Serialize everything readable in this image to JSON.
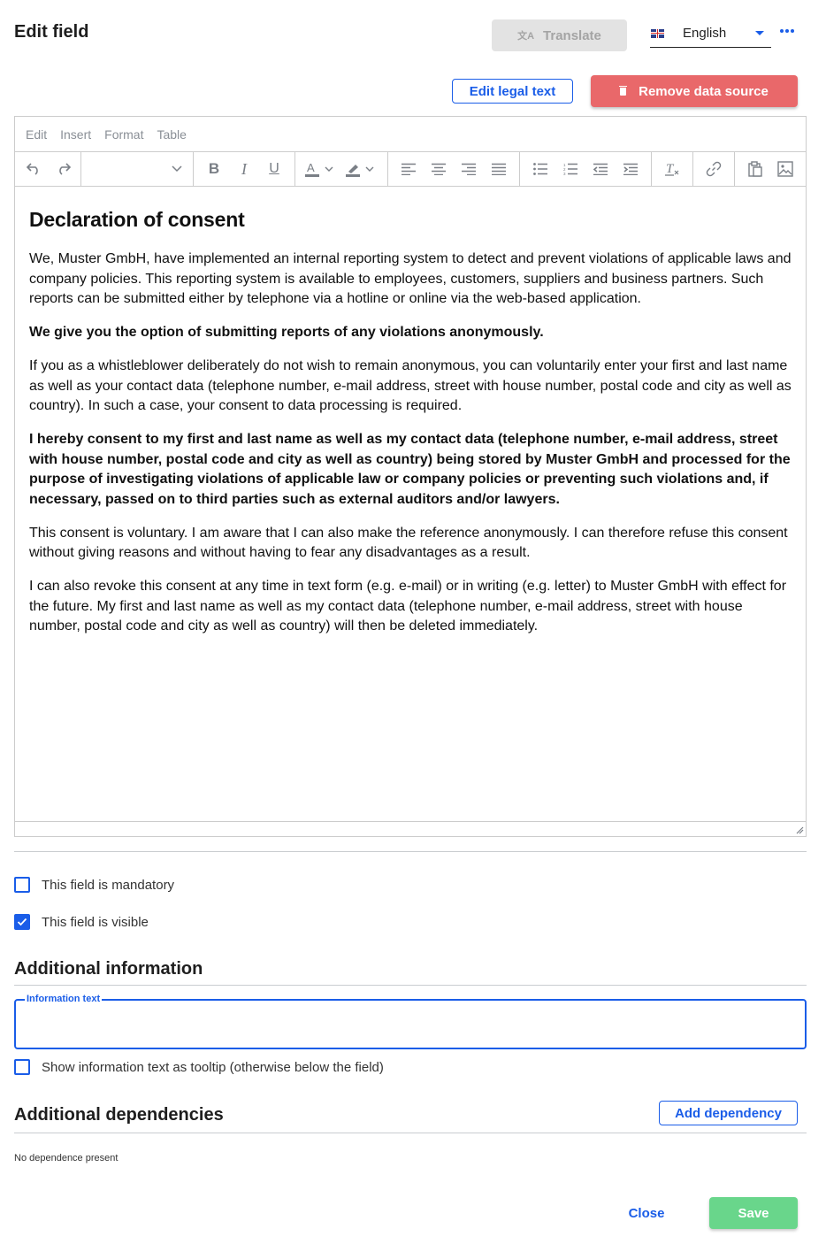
{
  "header": {
    "title": "Edit field",
    "translate_label": "Translate",
    "language": {
      "selected": "English",
      "flag_icon": "uk-flag-icon"
    },
    "more_icon": "more-horizontal-icon"
  },
  "actions": {
    "edit_legal_text_label": "Edit legal text",
    "remove_data_source_label": "Remove data source"
  },
  "editor": {
    "menu": [
      "Edit",
      "Insert",
      "Format",
      "Table"
    ],
    "toolbar": {
      "history": [
        "undo-icon",
        "redo-icon"
      ],
      "block_format": "",
      "formatting": [
        "bold-icon",
        "italic-icon",
        "underline-icon"
      ],
      "colors": [
        "text-color-icon",
        "highlight-color-icon"
      ],
      "alignment": [
        "align-left-icon",
        "align-center-icon",
        "align-right-icon",
        "align-justify-icon"
      ],
      "lists": [
        "bullet-list-icon",
        "numbered-list-icon",
        "outdent-icon",
        "indent-icon"
      ],
      "clear": [
        "clear-formatting-icon"
      ],
      "link": [
        "link-icon"
      ],
      "insert": [
        "paste-icon",
        "image-icon"
      ]
    },
    "content": {
      "heading": "Declaration of consent",
      "paragraphs": [
        {
          "bold": false,
          "text": "We, Muster GmbH, have implemented an internal reporting system to detect and prevent violations of applicable laws and company policies. This reporting system is available to employees, customers, suppliers and business partners. Such reports can be submitted either by telephone via a hotline or online via the web-based application."
        },
        {
          "bold": true,
          "text": "We give you the option of submitting reports of any violations anonymously."
        },
        {
          "bold": false,
          "text": "If you as a whistleblower deliberately do not wish to remain anonymous, you can voluntarily enter your first and last name as well as your contact data (telephone number, e-mail address, street with house number, postal code and city as well as country). In such a case, your consent to data processing is required."
        },
        {
          "bold": true,
          "text": "I hereby consent to my first and last name as well as my contact data (telephone number, e-mail address, street with house number, postal code and city as well as country) being stored by Muster GmbH and processed for the purpose of investigating violations of applicable law or company policies or preventing such violations and, if necessary, passed on to third parties such as external auditors and/or lawyers."
        },
        {
          "bold": false,
          "text": "This consent is voluntary. I am aware that I can also make the reference anonymously. I can therefore refuse this consent without giving reasons and without having to fear any disadvantages as a result."
        },
        {
          "bold": false,
          "text": "I can also revoke this consent at any time in text form (e.g. e-mail) or in writing (e.g. letter) to Muster GmbH with effect for the future. My first and last name as well as my contact data (telephone number, e-mail address, street with house number, postal code and city as well as country) will then be deleted immediately."
        }
      ]
    }
  },
  "options": {
    "mandatory": {
      "label": "This field is mandatory",
      "checked": false
    },
    "visible": {
      "label": "This field is visible",
      "checked": true
    }
  },
  "additional_information": {
    "title": "Additional information",
    "info_text": {
      "label": "Information text",
      "value": ""
    },
    "tooltip": {
      "label": "Show information text as tooltip (otherwise below the field)",
      "checked": false
    }
  },
  "additional_dependencies": {
    "title": "Additional dependencies",
    "add_label": "Add dependency",
    "empty_text": "No dependence present"
  },
  "footer": {
    "close_label": "Close",
    "save_label": "Save"
  },
  "colors": {
    "primary": "#1a5de8",
    "danger": "#e9686a",
    "success": "#69d68b",
    "disabled_bg": "#e3e3e3"
  }
}
